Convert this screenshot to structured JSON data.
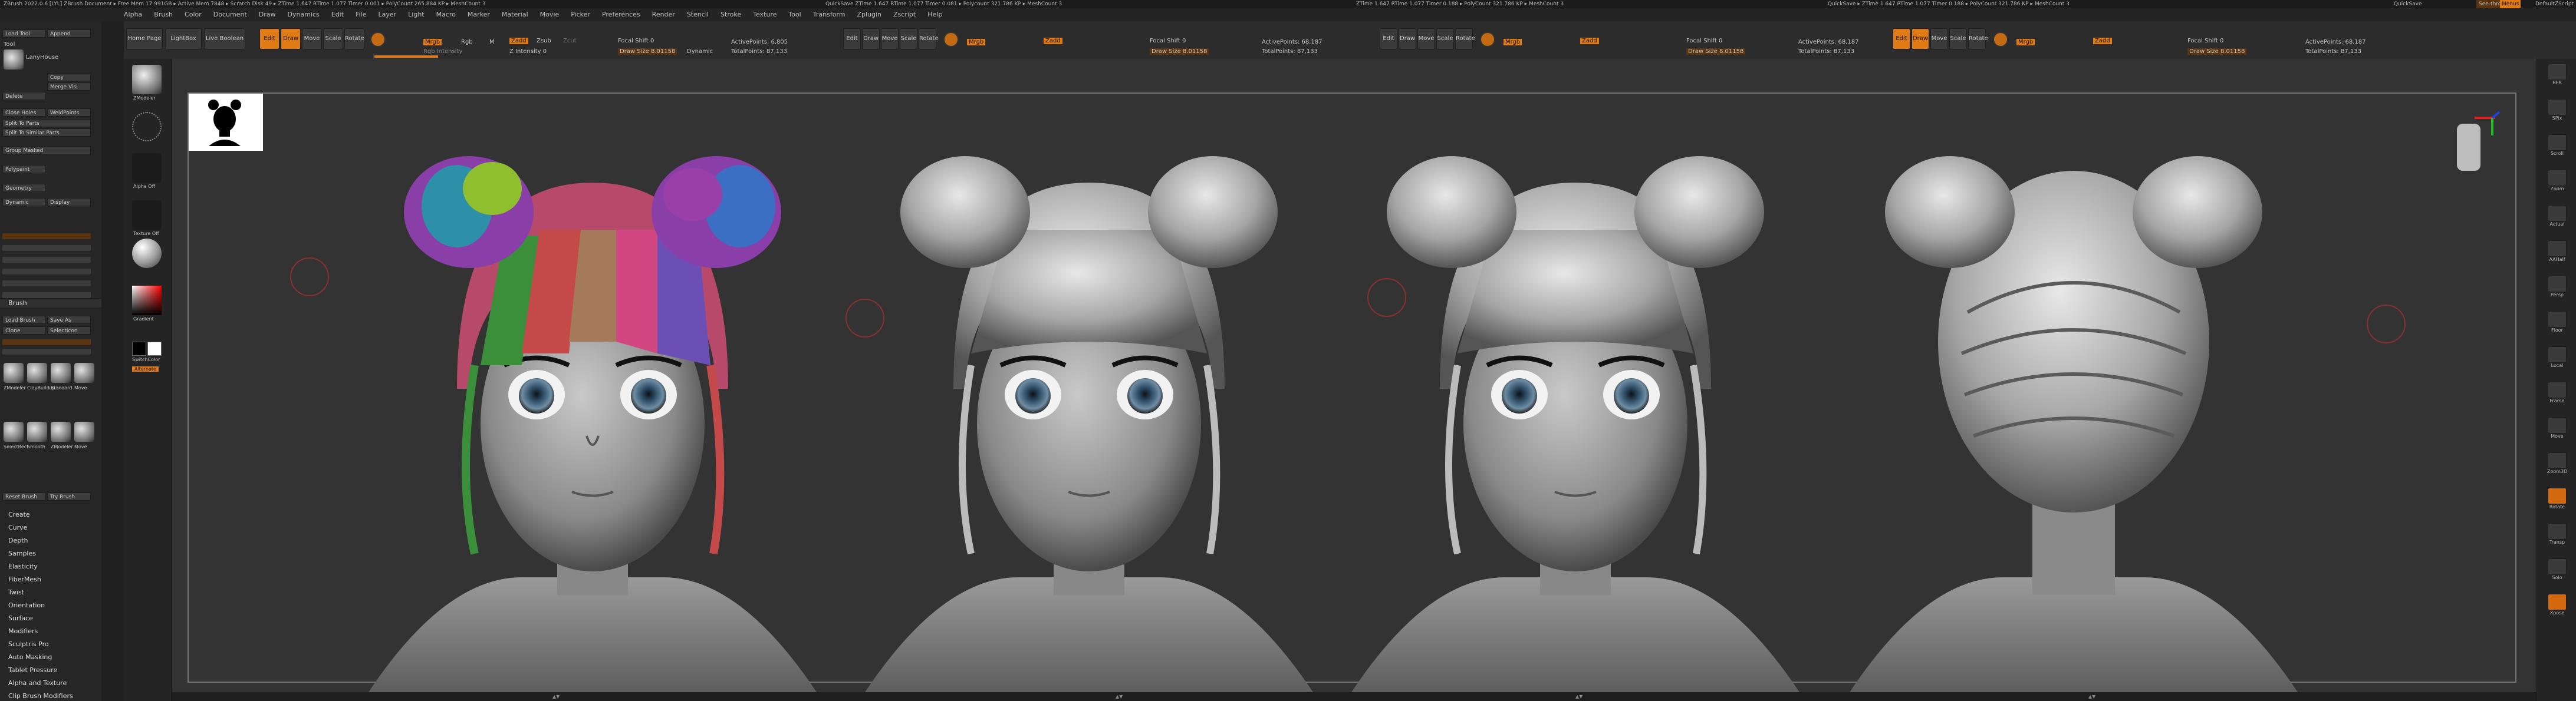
{
  "titlebar": {
    "left": "ZBrush 2022.0.6 [LYL]   ZBrush Document     ▸ Free Mem 17.991GB ▸ Active Mem 7848 ▸ Scratch Disk 49 ▸ ZTime 1.647 RTime 1.077 Timer 0.001 ▸ PolyCount 265.884 KP ▸ MeshCount 3",
    "mid1": "QuickSave ZTime 1.647 RTime 1.077 Timer 0.081 ▸ Polycount 321.786 KP ▸ MeshCount 3",
    "mid2": "ZTime 1.647 RTime 1.077 Timer 0.188 ▸ PolyCount 321.786 KP ▸ MeshCount 3",
    "right": "QuickSave ▸ ZTime 1.647 RTime 1.077 Timer 0.188 ▸ PolyCount 321.786 KP ▸ MeshCount 3",
    "quicksave": "QuickSave",
    "seethrough": "See-through",
    "menus_label": "Menus",
    "script": "DefaultZScript"
  },
  "menus": [
    "Alpha",
    "Brush",
    "Color",
    "Document",
    "Draw",
    "Dynamics",
    "Edit",
    "File",
    "Layer",
    "Light",
    "Macro",
    "Marker",
    "Material",
    "Movie",
    "Picker",
    "Preferences",
    "Render",
    "Stencil",
    "Stroke",
    "Texture",
    "Tool",
    "Transform",
    "Zplugin",
    "Zscript",
    "Help"
  ],
  "toolshelf": {
    "home_page": "Home Page",
    "lightbox": "LightBox",
    "live_boolean": "Live Boolean",
    "edit": "Edit",
    "draw": "Draw",
    "move": "Move",
    "scale": "Scale",
    "rotate": "Rotate",
    "mrgb": "Mrgb",
    "rgb": "Rgb",
    "m": "M",
    "zadd": "Zadd",
    "zsub": "Zsub",
    "zcut": "Zcut",
    "rgb_intensity": "Rgb Intensity",
    "z_intensity": "Z Intensity 0",
    "focal_shift": "Focal Shift 0",
    "draw_size": "Draw Size 8.01158",
    "dynamic": "Dynamic",
    "active_points": "ActivePoints: 6,805",
    "total_points": "TotalPoints: 87,133",
    "active_points_2": "ActivePoints: 68,187",
    "total_points_2": "TotalPoints: 87,133"
  },
  "leftpanel": {
    "load_tool": "Load Tool",
    "append": "Append",
    "tool_label": "Tool",
    "lighthouse": "LanyHouse",
    "subtool_header": "Subtool",
    "copy": "Copy",
    "merge": "Merge Visi",
    "delete": "Delete",
    "close_holes": "Close Holes",
    "weld_points": "WeldPoints",
    "split_to_parts": "Split To Parts",
    "split_unmasked": "Split To Similar Parts",
    "groups_masked": "Group Masked",
    "polypaint": "Polypaint",
    "geometry": "Geometry",
    "dynamic": "Dynamic",
    "display": "Display",
    "brush_header": "Brush",
    "load_brush": "Load Brush",
    "save_as": "Save As",
    "clone": "Clone",
    "select_icon": "SelectIcon",
    "brush_names": [
      "ZModeler",
      "ClayBuildup",
      "Standard",
      "Move",
      "SelectRect",
      "Smooth",
      "ZModeler",
      "Move"
    ],
    "reset_brush": "Reset Brush",
    "try_brush": "Try Brush",
    "sections": [
      "Create",
      "Curve",
      "Depth",
      "Samples",
      "Elasticity",
      "FiberMesh",
      "Twist",
      "Orientation",
      "Surface",
      "Modifiers",
      "Sculptris Pro",
      "Auto Masking",
      "Tablet Pressure",
      "Alpha and Texture",
      "Clip Brush Modifiers"
    ]
  },
  "midpanel": {
    "zmodeler": "ZModeler",
    "alpha_off": "Alpha Off",
    "texture_off": "Texture Off",
    "gradient": "Gradient",
    "switch_color": "SwitchColor",
    "alternate": "Alternate"
  },
  "rightpanel": {
    "items": [
      "BPR",
      "SPix",
      "Scroll",
      "Zoom",
      "Actual",
      "AAHalf",
      "Persp",
      "Floor",
      "Local",
      "Frame",
      "Move",
      "Zoom3D",
      "Rotate",
      "Transp",
      "Solo",
      "Xpose"
    ]
  },
  "bottombar": {
    "marks": "▲▼"
  },
  "colors": {
    "accent": "#e07a14",
    "viewport_bg": "#333333"
  }
}
